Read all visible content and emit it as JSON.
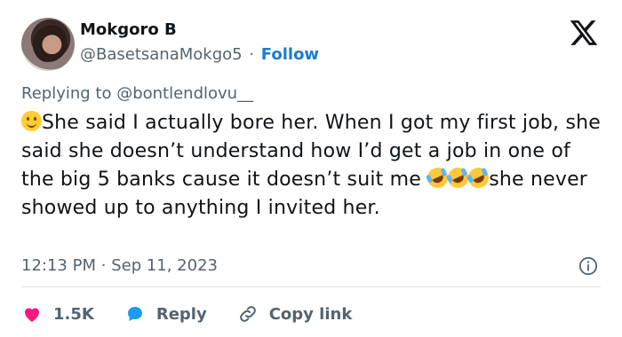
{
  "author": {
    "name": "Mokgoro B",
    "handle": "@BasetsanaMokgo5",
    "separator": "·",
    "follow_label": "Follow"
  },
  "brand": {
    "logo_icon": "x-logo-icon",
    "accent": "#1d7ccf"
  },
  "reply_context": {
    "prefix": "Replying to ",
    "to_handle": "@bontlendlovu__"
  },
  "tweet": {
    "text_part1": "She said I actually bore her. When I got my first job, she said she doesn’t understand how I’d get a job in one of the big 5 banks cause it doesn’t suit me ",
    "text_part2": "she never showed up to anything I invited her.",
    "emoji_leading": "slightly-smiling-face-icon",
    "emoji_inline": [
      "rofl-icon",
      "rofl-icon",
      "rofl-icon"
    ]
  },
  "meta": {
    "time": "12:13 PM",
    "separator": "·",
    "date": "Sep 11, 2023",
    "info_icon": "info-icon"
  },
  "actions": {
    "like_count": "1.5K",
    "like_color": "#f91880",
    "reply_label": "Reply",
    "reply_color": "#1d9bf0",
    "copy_label": "Copy link"
  }
}
